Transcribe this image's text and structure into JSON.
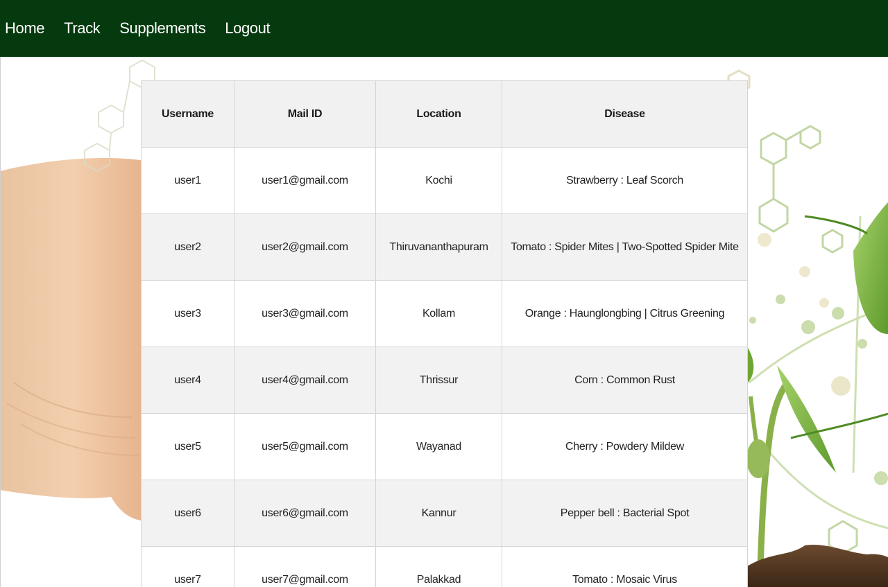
{
  "nav": {
    "items": [
      {
        "label": "Home"
      },
      {
        "label": "Track"
      },
      {
        "label": "Supplements"
      },
      {
        "label": "Logout"
      }
    ]
  },
  "table": {
    "headers": [
      "Username",
      "Mail ID",
      "Location",
      "Disease"
    ],
    "rows": [
      [
        "user1",
        "user1@gmail.com",
        "Kochi",
        "Strawberry : Leaf Scorch"
      ],
      [
        "user2",
        "user2@gmail.com",
        "Thiruvananthapuram",
        "Tomato : Spider Mites | Two-Spotted Spider Mite"
      ],
      [
        "user3",
        "user3@gmail.com",
        "Kollam",
        "Orange : Haunglongbing | Citrus Greening"
      ],
      [
        "user4",
        "user4@gmail.com",
        "Thrissur",
        "Corn : Common Rust"
      ],
      [
        "user5",
        "user5@gmail.com",
        "Wayanad",
        "Cherry : Powdery Mildew"
      ],
      [
        "user6",
        "user6@gmail.com",
        "Kannur",
        "Pepper bell : Bacterial Spot"
      ],
      [
        "user7",
        "user7@gmail.com",
        "Palakkad",
        "Tomato : Mosaic Virus"
      ]
    ]
  },
  "colors": {
    "navbar": "#053a0f",
    "header_bg": "#f1f1f1",
    "row_alt_bg": "#f2f2f2"
  }
}
